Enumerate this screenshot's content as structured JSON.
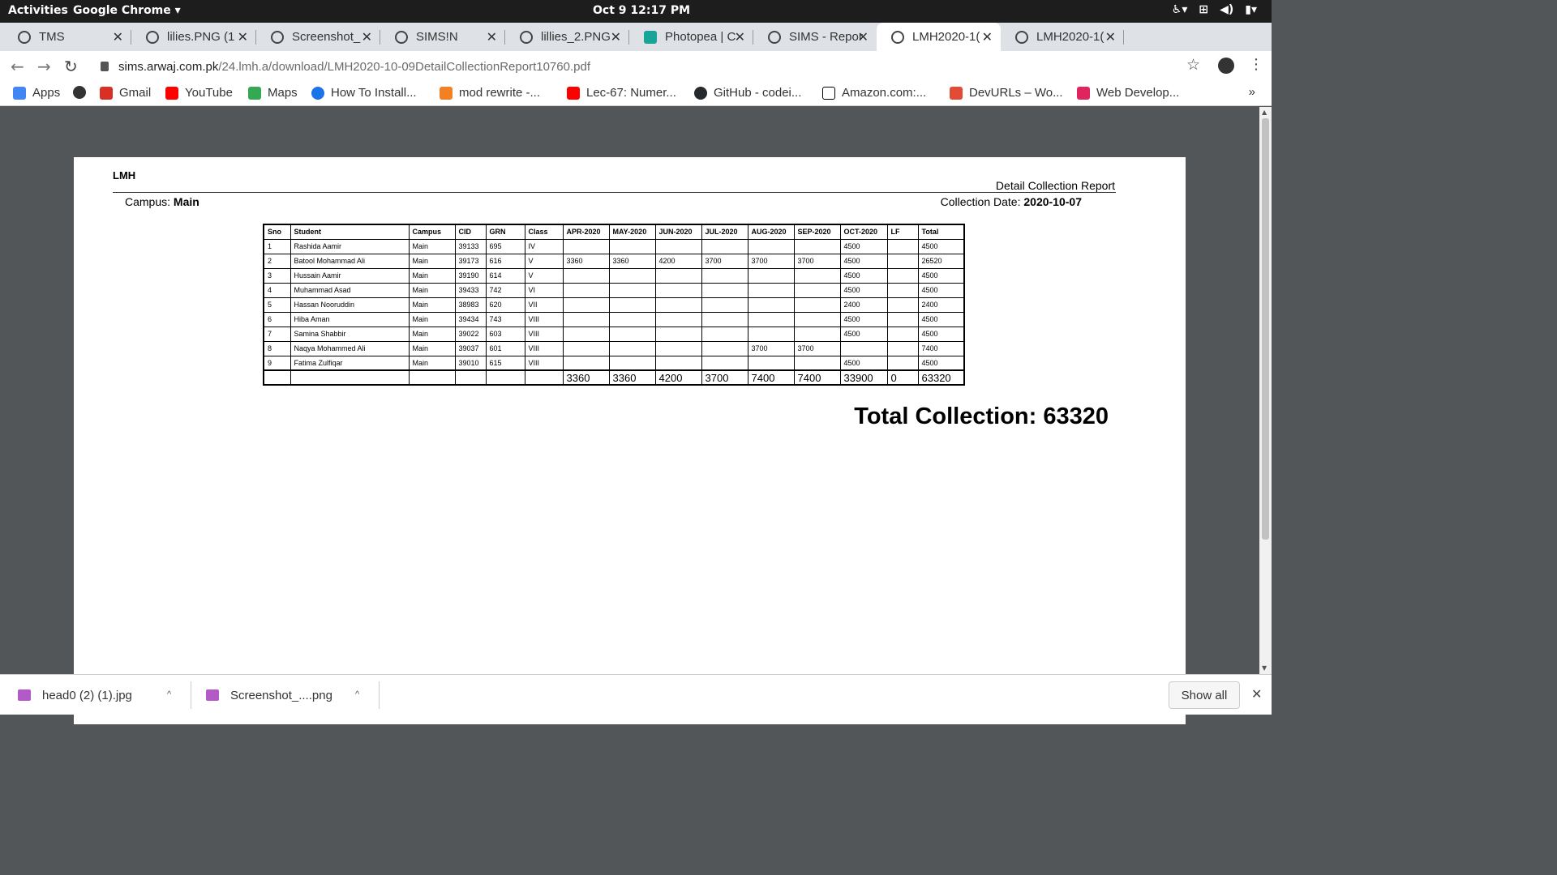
{
  "topbar": {
    "activities": "Activities",
    "app_name": "Google Chrome ▾",
    "clock": "Oct 9  12:17 PM",
    "tray_icons": [
      "accessibility-icon",
      "network-icon",
      "volume-icon",
      "battery-icon"
    ]
  },
  "tabs": [
    {
      "title": "TMS",
      "active": false
    },
    {
      "title": "lilies.PNG (1",
      "active": false
    },
    {
      "title": "Screenshot_",
      "active": false
    },
    {
      "title": "SIMS!N",
      "active": false
    },
    {
      "title": "lillies_2.PNG",
      "active": false
    },
    {
      "title": "Photopea | C",
      "active": false
    },
    {
      "title": "SIMS - Repor",
      "active": false
    },
    {
      "title": "LMH2020-1(",
      "active": true
    },
    {
      "title": "LMH2020-1(",
      "active": false
    }
  ],
  "omnibox": {
    "host": "sims.arwaj.com.pk",
    "path": "/24.lmh.a/download/LMH2020-10-09DetailCollectionReport10760.pdf"
  },
  "bookmarks": [
    {
      "label": "Apps",
      "color": "#4285f4"
    },
    {
      "label": "",
      "color": "#333333"
    },
    {
      "label": "Gmail",
      "color": "#d93025"
    },
    {
      "label": "YouTube",
      "color": "#ff0000"
    },
    {
      "label": "Maps",
      "color": "#34a853"
    },
    {
      "label": "How To Install...",
      "color": "#1a73e8"
    },
    {
      "label": "mod rewrite -...",
      "color": "#f48024"
    },
    {
      "label": "Lec-67: Numer...",
      "color": "#ff0000"
    },
    {
      "label": "GitHub - codei...",
      "color": "#24292e"
    },
    {
      "label": "Amazon.com:...",
      "color": "#000000"
    },
    {
      "label": "DevURLs – Wo...",
      "color": "#e24b36"
    },
    {
      "label": "Web Develop...",
      "color": "#e0245e"
    }
  ],
  "bookmarks_more": "»",
  "report": {
    "org": "LMH",
    "title": "Detail Collection Report",
    "campus_label": "Campus:",
    "campus_value": "Main",
    "date_label": "Collection Date:",
    "date_value": "2020-10-07",
    "columns": [
      "Sno",
      "Student",
      "Campus",
      "CID",
      "GRN",
      "Class",
      "APR-2020",
      "MAY-2020",
      "JUN-2020",
      "JUL-2020",
      "AUG-2020",
      "SEP-2020",
      "OCT-2020",
      "LF",
      "Total"
    ],
    "rows": [
      [
        "1",
        "Rashida Aamir",
        "Main",
        "39133",
        "695",
        "IV",
        "",
        "",
        "",
        "",
        "",
        "",
        "4500",
        "",
        "4500"
      ],
      [
        "2",
        "Batool Mohammad Ali",
        "Main",
        "39173",
        "616",
        "V",
        "3360",
        "3360",
        "4200",
        "3700",
        "3700",
        "3700",
        "4500",
        "",
        "26520"
      ],
      [
        "3",
        "Hussain Aamir",
        "Main",
        "39190",
        "614",
        "V",
        "",
        "",
        "",
        "",
        "",
        "",
        "4500",
        "",
        "4500"
      ],
      [
        "4",
        "Muhammad Asad",
        "Main",
        "39433",
        "742",
        "VI",
        "",
        "",
        "",
        "",
        "",
        "",
        "4500",
        "",
        "4500"
      ],
      [
        "5",
        "Hassan Nooruddin",
        "Main",
        "38983",
        "620",
        "VII",
        "",
        "",
        "",
        "",
        "",
        "",
        "2400",
        "",
        "2400"
      ],
      [
        "6",
        "Hiba Aman",
        "Main",
        "39434",
        "743",
        "VIII",
        "",
        "",
        "",
        "",
        "",
        "",
        "4500",
        "",
        "4500"
      ],
      [
        "7",
        "Samina Shabbir",
        "Main",
        "39022",
        "603",
        "VIII",
        "",
        "",
        "",
        "",
        "",
        "",
        "4500",
        "",
        "4500"
      ],
      [
        "8",
        "Naqya Mohammed Ali",
        "Main",
        "39037",
        "601",
        "VIII",
        "",
        "",
        "",
        "",
        "3700",
        "3700",
        "",
        "",
        "7400"
      ],
      [
        "9",
        "Fatima Zulfiqar",
        "Main",
        "39010",
        "615",
        "VIII",
        "",
        "",
        "",
        "",
        "",
        "",
        "4500",
        "",
        "4500"
      ]
    ],
    "totals": [
      "",
      "",
      "",
      "",
      "",
      "",
      "3360",
      "3360",
      "4200",
      "3700",
      "7400",
      "7400",
      "33900",
      "0",
      "63320"
    ],
    "total_collection": "Total Collection: 63320"
  },
  "downloads": [
    {
      "name": "head0 (2) (1).jpg"
    },
    {
      "name": "Screenshot_....png"
    }
  ],
  "show_all": "Show all"
}
